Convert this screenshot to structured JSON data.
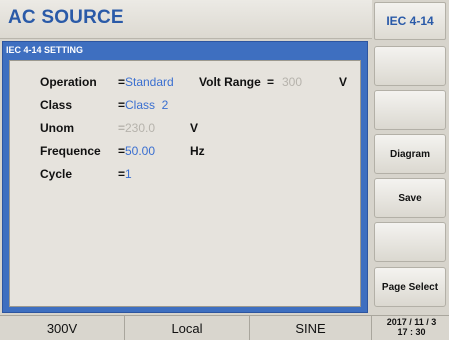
{
  "header": {
    "title": "AC SOURCE",
    "mode_badge": "IEC 4-14"
  },
  "panel": {
    "title": "IEC 4-14 SETTING",
    "fields": {
      "operation": {
        "label": "Operation",
        "eq": "=",
        "value": "Standard"
      },
      "volt_range": {
        "label": "Volt Range",
        "eq": "=",
        "value": "300",
        "unit": "V"
      },
      "class": {
        "label": "Class",
        "eq": "=",
        "value": "Class  2"
      },
      "unom": {
        "label": "Unom",
        "eq": "=",
        "value": "230.0",
        "unit": "V"
      },
      "frequence": {
        "label": "Frequence",
        "eq": "=",
        "value": "50.00",
        "unit": "Hz"
      },
      "cycle": {
        "label": "Cycle",
        "eq": "=",
        "value": "1"
      }
    }
  },
  "side_buttons": [
    "",
    "",
    "Diagram",
    "Save",
    "",
    "Page Select"
  ],
  "status_bar": {
    "range": "300V",
    "control": "Local",
    "waveform": "SINE",
    "date": "2017 / 11 / 3",
    "time": "17 : 30"
  }
}
